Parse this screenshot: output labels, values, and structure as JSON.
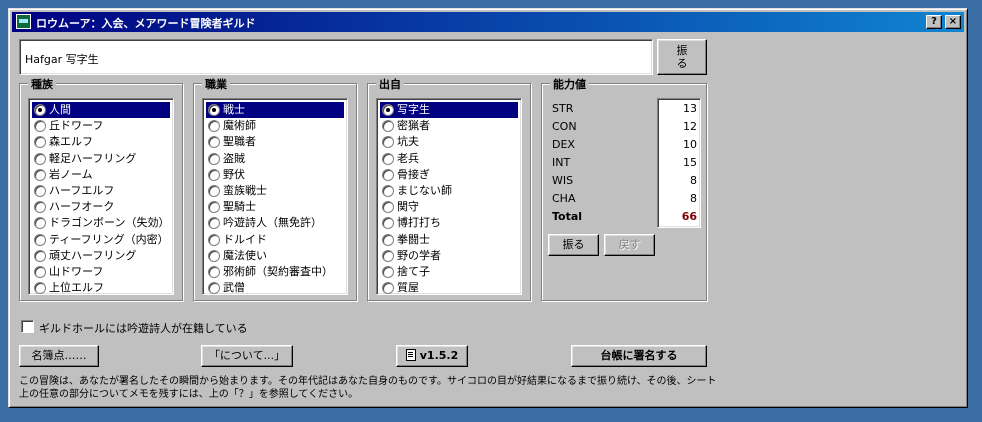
{
  "window": {
    "title": "ロウムーア：入会、メアワード冒険者ギルド",
    "help_label": "?",
    "close_label": "×"
  },
  "name_field": {
    "value": "Hafgar 写字生",
    "roll_label": "振\nる"
  },
  "race": {
    "label": "種族",
    "items": [
      "人間",
      "丘ドワーフ",
      "森エルフ",
      "軽足ハーフリング",
      "岩ノーム",
      "ハーフエルフ",
      "ハーフオーク",
      "ドラゴンボーン（失効）",
      "ティーフリング（内密）",
      "頑丈ハーフリング",
      "山ドワーフ",
      "上位エルフ"
    ],
    "selected": 0
  },
  "class": {
    "label": "職業",
    "items": [
      "戦士",
      "魔術師",
      "聖職者",
      "盗賊",
      "野伏",
      "蛮族戦士",
      "聖騎士",
      "吟遊詩人（無免許）",
      "ドルイド",
      "魔法使い",
      "邪術師（契約審査中）",
      "武僧"
    ],
    "selected": 0
  },
  "origin": {
    "label": "出自",
    "items": [
      "写字生",
      "密猟者",
      "坑夫",
      "老兵",
      "骨接ぎ",
      "まじない師",
      "関守",
      "博打打ち",
      "拳闘士",
      "野の学者",
      "捨て子",
      "質屋"
    ],
    "selected": 0
  },
  "stats": {
    "label": "能力値",
    "rows": [
      {
        "name": "STR",
        "value": "13"
      },
      {
        "name": "CON",
        "value": "12"
      },
      {
        "name": "DEX",
        "value": "10"
      },
      {
        "name": "INT",
        "value": "15"
      },
      {
        "name": "WIS",
        "value": "8"
      },
      {
        "name": "CHA",
        "value": "8"
      }
    ],
    "total_label": "Total",
    "total_value": "66",
    "total_color": "#800000",
    "roll_label": "振る",
    "undo_label": "戻す"
  },
  "bard_checkbox": {
    "label": "ギルドホールには吟遊詩人が在籍している",
    "checked": false
  },
  "buttons": {
    "roll_of_names": "名簿点……",
    "about": "「について...」",
    "version": "v1.5.2",
    "sign": "台帳に署名する"
  },
  "description": "この冒険は、あなたが署名したその瞬間から始まります。その年代記はあなた自身のものです。サイコロの目が好結果になるまで振り続け、その後、シート上の任意の部分についてメモを残すには、上の「？」を参照してください。",
  "icons": [
    "app-icon",
    "radio-icon",
    "document-icon"
  ]
}
